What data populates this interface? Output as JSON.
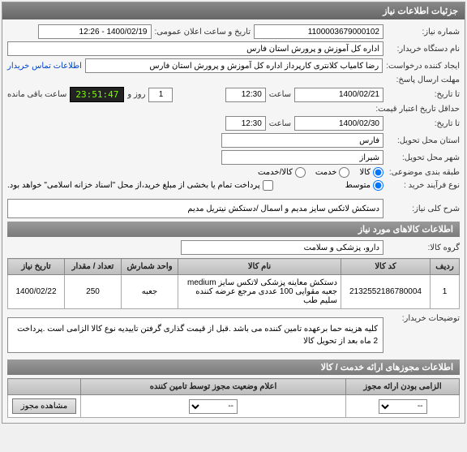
{
  "panel": {
    "title": "جزئیات اطلاعات نیاز"
  },
  "fields": {
    "need_no_label": "شماره نیاز:",
    "need_no": "1100003679000102",
    "announce_label": "تاریخ و ساعت اعلان عمومی:",
    "announce_val": "1400/02/19 - 12:26",
    "buyer_org_label": "نام دستگاه خریدار:",
    "buyer_org": "اداره کل آموزش و پرورش استان فارس",
    "requester_label": "ایجاد کننده درخواست:",
    "requester": "رضا کامیاب کلانتری کارپرداز اداره کل آموزش و پرورش استان فارس",
    "contact_link": "اطلاعات تماس خریدار",
    "deadline_label": "مهلت ارسال پاسخ:",
    "to_date_label": "تا تاریخ:",
    "deadline_date": "1400/02/21",
    "time_label": "ساعت",
    "deadline_time": "12:30",
    "day_label": "روز و",
    "days_remain": "1",
    "countdown": "23:51:47",
    "remain_label": "ساعت باقی مانده",
    "min_valid_label": "حداقل تاریخ اعتبار قیمت:",
    "min_valid_date": "1400/02/30",
    "min_valid_time": "12:30",
    "to_date_label2": "تا تاریخ:",
    "province_label": "استان محل تحویل:",
    "province": "فارس",
    "city_label": "شهر محل تحویل:",
    "city": "شیراز",
    "category_label": "طبقه بندی موضوعی:",
    "cat_goods_label": "کالا",
    "cat_service_label": "خدمت",
    "cat_goods_service_label": "کالا/خدمت",
    "process_label": "نوع فرآیند خرید :",
    "process_opt1": "متوسط",
    "payment_note": "پرداخت تمام یا بخشی از مبلغ خرید،از محل \"اسناد خزانه اسلامی\" خواهد بود.",
    "desc_label": "شرح کلی نیاز:",
    "desc_val": "دستکش لاتکس سایز مدیم و اسمال /دستکش نیتریل مدیم"
  },
  "items_header": "اطلاعات کالاهای مورد نیاز",
  "group_label": "گروه کالا:",
  "group_val": "دارو، پزشکی و سلامت",
  "table": {
    "headers": {
      "row": "ردیف",
      "code": "کد کالا",
      "name": "نام کالا",
      "unit": "واحد شمارش",
      "qty": "تعداد / مقدار",
      "need_date": "تاریخ نیاز"
    },
    "rows": [
      {
        "row": "1",
        "code": "2132552186780004",
        "name": "دستکش معاینه پزشکی لاتکس سایز medium جعبه مقوایی 100 عددی مرجع عرضه کننده سلیم طب",
        "unit": "جعبه",
        "qty": "250",
        "need_date": "1400/02/22"
      }
    ]
  },
  "buyer_notes_label": "توضیحات خریدار:",
  "buyer_notes": "کلیه هزینه حما برعهده تامین کننده می باشد .قبل از قیمت گذاری گرفتن تاییدیه نوع کالا الزامی است .پرداخت 2 ماه بعد از تحویل کالا",
  "auth_header": "اطلاعات مجوزهای ارائه خدمت / کالا",
  "auth_table": {
    "headers": {
      "mandatory": "الزامی بودن ارائه مجوز",
      "status": "اعلام وضعیت مجوز توسط تامین کننده"
    },
    "opt_dash": "--",
    "view_btn": "مشاهده مجوز"
  }
}
